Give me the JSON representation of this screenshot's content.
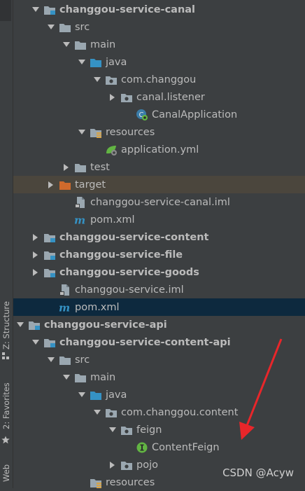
{
  "sidebar": {
    "structure_label": "Z: Structure",
    "favorites_label": "2: Favorites",
    "web_label": "Web"
  },
  "tree": [
    {
      "label": "changgou-service-canal",
      "bold": true,
      "icon": "module-folder-icon",
      "arrow": "down",
      "depth": 2
    },
    {
      "label": "src",
      "bold": false,
      "icon": "folder-icon",
      "arrow": "down",
      "depth": 3
    },
    {
      "label": "main",
      "bold": false,
      "icon": "folder-icon",
      "arrow": "down",
      "depth": 4
    },
    {
      "label": "java",
      "bold": false,
      "icon": "source-folder-icon",
      "arrow": "down",
      "depth": 5
    },
    {
      "label": "com.changgou",
      "bold": false,
      "icon": "package-icon",
      "arrow": "down",
      "depth": 6
    },
    {
      "label": "canal.listener",
      "bold": false,
      "icon": "package-icon",
      "arrow": "right",
      "depth": 7
    },
    {
      "label": "CanalApplication",
      "bold": false,
      "icon": "spring-class-icon",
      "arrow": "none",
      "depth": 8
    },
    {
      "label": "resources",
      "bold": false,
      "icon": "resources-folder-icon",
      "arrow": "down",
      "depth": 5
    },
    {
      "label": "application.yml",
      "bold": false,
      "icon": "spring-yml-icon",
      "arrow": "none",
      "depth": 6
    },
    {
      "label": "test",
      "bold": false,
      "icon": "folder-icon",
      "arrow": "right",
      "depth": 4
    },
    {
      "label": "target",
      "bold": false,
      "icon": "excluded-folder-icon",
      "arrow": "right",
      "depth": 3,
      "highlight": "target"
    },
    {
      "label": "changgou-service-canal.iml",
      "bold": false,
      "icon": "iml-file-icon",
      "arrow": "none",
      "depth": 4
    },
    {
      "label": "pom.xml",
      "bold": false,
      "icon": "maven-icon",
      "arrow": "none",
      "depth": 4
    },
    {
      "label": "changgou-service-content",
      "bold": true,
      "icon": "module-folder-icon",
      "arrow": "right",
      "depth": 2
    },
    {
      "label": "changgou-service-file",
      "bold": true,
      "icon": "module-folder-icon",
      "arrow": "right",
      "depth": 2
    },
    {
      "label": "changgou-service-goods",
      "bold": true,
      "icon": "module-folder-icon",
      "arrow": "right",
      "depth": 2
    },
    {
      "label": "changgou-service.iml",
      "bold": false,
      "icon": "iml-file-icon",
      "arrow": "none",
      "depth": 3
    },
    {
      "label": "pom.xml",
      "bold": false,
      "icon": "maven-icon",
      "arrow": "none",
      "depth": 3,
      "highlight": "pom"
    },
    {
      "label": "changgou-service-api",
      "bold": true,
      "icon": "module-folder-icon",
      "arrow": "down",
      "depth": 1
    },
    {
      "label": "changgou-service-content-api",
      "bold": true,
      "icon": "module-folder-icon",
      "arrow": "down",
      "depth": 2
    },
    {
      "label": "src",
      "bold": false,
      "icon": "folder-icon",
      "arrow": "down",
      "depth": 3
    },
    {
      "label": "main",
      "bold": false,
      "icon": "folder-icon",
      "arrow": "down",
      "depth": 4
    },
    {
      "label": "java",
      "bold": false,
      "icon": "source-folder-icon",
      "arrow": "down",
      "depth": 5
    },
    {
      "label": "com.changgou.content",
      "bold": false,
      "icon": "package-icon",
      "arrow": "down",
      "depth": 6
    },
    {
      "label": "feign",
      "bold": false,
      "icon": "package-icon",
      "arrow": "down",
      "depth": 7
    },
    {
      "label": "ContentFeign",
      "bold": false,
      "icon": "interface-icon",
      "arrow": "none",
      "depth": 8
    },
    {
      "label": "pojo",
      "bold": false,
      "icon": "package-icon",
      "arrow": "right",
      "depth": 7
    },
    {
      "label": "resources",
      "bold": false,
      "icon": "resources-folder-icon",
      "arrow": "none",
      "depth": 5
    }
  ],
  "watermark": "CSDN @Acyw",
  "colors": {
    "background": "#3c3f41",
    "text": "#bbbbbb",
    "target_highlight": "#4b463d",
    "pom_highlight": "#0d293e",
    "annotation_arrow": "#e8262a"
  }
}
